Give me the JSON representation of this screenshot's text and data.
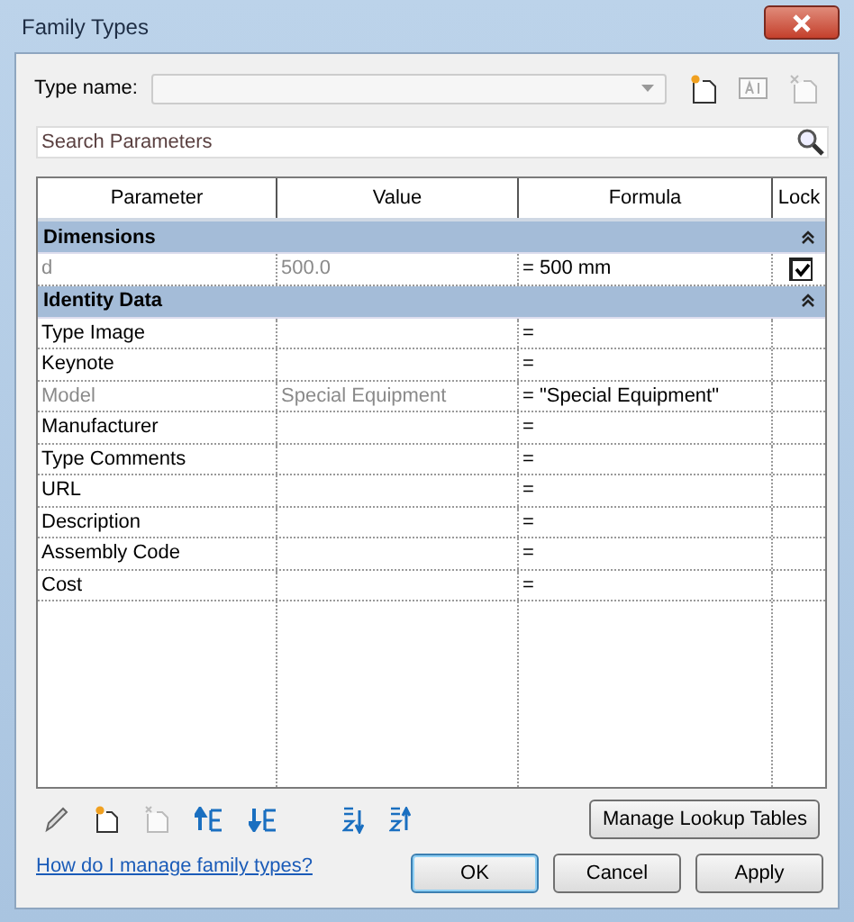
{
  "window": {
    "title": "Family Types"
  },
  "type_name": {
    "label": "Type name:"
  },
  "search": {
    "placeholder": "Search Parameters"
  },
  "table": {
    "columns": [
      "Parameter",
      "Value",
      "Formula",
      "Lock"
    ],
    "groups": [
      {
        "title": "Dimensions",
        "expanded": true,
        "rows": [
          {
            "kind": "dimension",
            "parameter": "d",
            "value": "500.0",
            "formula": "= 500 mm",
            "disabled": true,
            "locked": true
          }
        ]
      },
      {
        "title": "Identity Data",
        "expanded": true,
        "rows": [
          {
            "kind": "text",
            "parameter": "Type Image",
            "formula": "=",
            "disabled": false
          },
          {
            "kind": "text",
            "parameter": "Keynote",
            "formula": "=",
            "disabled": false
          },
          {
            "kind": "text",
            "parameter": "Model",
            "value": "Special Equipment",
            "formula": "= \"Special Equipment\"",
            "disabled": true
          },
          {
            "kind": "text",
            "parameter": "Manufacturer",
            "formula": "=",
            "disabled": false
          },
          {
            "kind": "text",
            "parameter": "Type Comments",
            "formula": "=",
            "disabled": false
          },
          {
            "kind": "text",
            "parameter": "URL",
            "formula": "=",
            "disabled": false
          },
          {
            "kind": "text",
            "parameter": "Description",
            "formula": "=",
            "disabled": false
          },
          {
            "kind": "text",
            "parameter": "Assembly Code",
            "formula": "=",
            "disabled": false
          },
          {
            "kind": "text",
            "parameter": "Cost",
            "formula": "=",
            "disabled": false
          }
        ]
      }
    ]
  },
  "manage_button": "Manage Lookup Tables",
  "help_link": "How do I manage family types?",
  "buttons": [
    "OK",
    "Cancel",
    "Apply"
  ]
}
